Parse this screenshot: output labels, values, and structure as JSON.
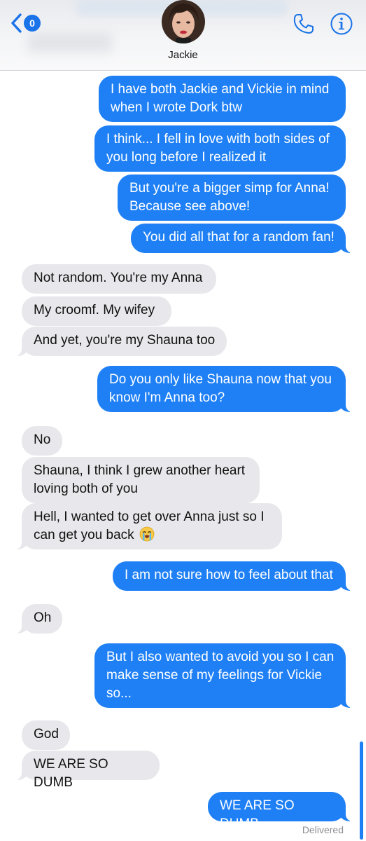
{
  "header": {
    "contact_name": "Jackie",
    "unread_badge": "0",
    "icons": {
      "back": "chevron-left-icon",
      "phone": "phone-icon",
      "info": "info-icon"
    }
  },
  "colors": {
    "sent_bubble": "#1f80f5",
    "received_bubble": "#e8e8ec",
    "accent": "#1a73e8"
  },
  "messages": [
    {
      "side": "sent",
      "text": "I have both Jackie and Vickie in mind when I wrote Dork btw"
    },
    {
      "side": "sent",
      "text": "I think... I fell in love with both sides of you long before I realized it"
    },
    {
      "side": "sent",
      "text": "But you're a bigger simp for Anna! Because see above!"
    },
    {
      "side": "sent",
      "text": "You did all that for a random fan!"
    },
    {
      "side": "received",
      "text": "Not random. You're my Anna"
    },
    {
      "side": "received",
      "text": "My croomf. My wifey"
    },
    {
      "side": "received",
      "text": "And yet, you're my Shauna too"
    },
    {
      "side": "sent",
      "text": "Do you only like Shauna now that you know I'm Anna too?"
    },
    {
      "side": "received",
      "text": "No"
    },
    {
      "side": "received",
      "text": "Shauna, I think I grew another heart loving both of you"
    },
    {
      "side": "received",
      "text": "Hell, I wanted to get over Anna just so  I can get you back",
      "emoji": "loudly-crying-face"
    },
    {
      "side": "sent",
      "text": "I am not sure how to feel about that"
    },
    {
      "side": "received",
      "text": "Oh"
    },
    {
      "side": "sent",
      "text": "But I also wanted to avoid you so I can make sense of my feelings for Vickie so..."
    },
    {
      "side": "received",
      "text": "God"
    },
    {
      "side": "received",
      "text": "WE ARE SO DUMB"
    },
    {
      "side": "sent",
      "text": "WE ARE SO DUMB"
    }
  ],
  "status": {
    "delivered": "Delivered"
  }
}
